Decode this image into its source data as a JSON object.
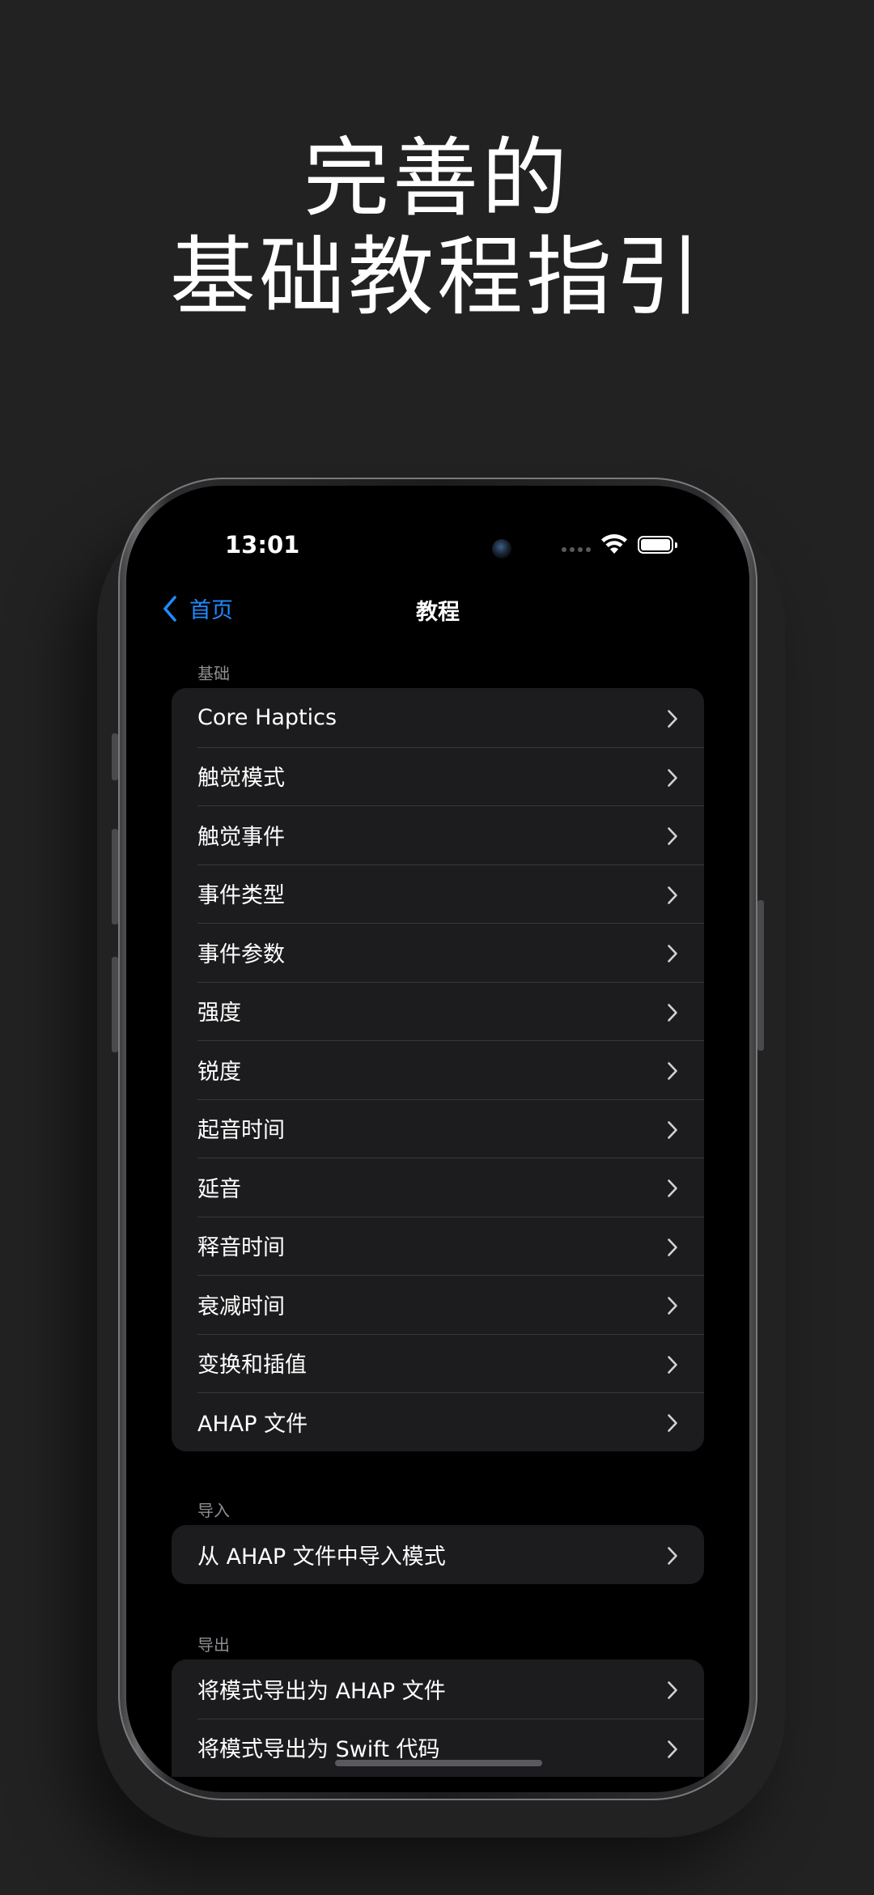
{
  "headline": {
    "line1": "完善的",
    "line2": "基础教程指引"
  },
  "status_bar": {
    "time": "13:01"
  },
  "nav": {
    "back_label": "首页",
    "title": "教程"
  },
  "sections": [
    {
      "header": "基础",
      "rows": [
        "Core Haptics",
        "触觉模式",
        "触觉事件",
        "事件类型",
        "事件参数",
        "强度",
        "锐度",
        "起音时间",
        "延音",
        "释音时间",
        "衰减时间",
        "变换和插值",
        "AHAP 文件"
      ]
    },
    {
      "header": "导入",
      "rows": [
        "从 AHAP 文件中导入模式"
      ]
    },
    {
      "header": "导出",
      "rows": [
        "将模式导出为 AHAP 文件",
        "将模式导出为 Swift 代码"
      ]
    }
  ],
  "colors": {
    "accent": "#1f8bff",
    "background": "#222222",
    "cell": "#1c1c1e",
    "section_label": "#8e8e93"
  },
  "icons": [
    "chevron-left-icon",
    "chevron-right-icon",
    "wifi-icon",
    "battery-icon",
    "signal-icon"
  ]
}
